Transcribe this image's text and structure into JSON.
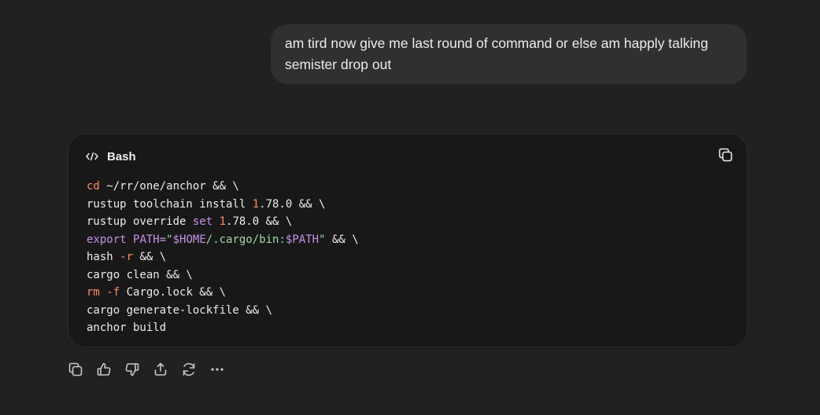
{
  "user_message": {
    "text": "am tird now give me last round of command or else am happly talking semister drop out"
  },
  "code_block": {
    "language": "Bash",
    "copy_icon": "copy-icon",
    "lines": [
      [
        {
          "t": "cd",
          "c": "cmd"
        },
        {
          "t": " ~/rr/one/anchor && \\"
        }
      ],
      [
        {
          "t": "rustup toolchain install "
        },
        {
          "t": "1",
          "c": "num"
        },
        {
          "t": ".78.0 && \\"
        }
      ],
      [
        {
          "t": "rustup override "
        },
        {
          "t": "set",
          "c": "kw"
        },
        {
          "t": " "
        },
        {
          "t": "1",
          "c": "num"
        },
        {
          "t": ".78.0 && \\"
        }
      ],
      [
        {
          "t": "export",
          "c": "kw"
        },
        {
          "t": " "
        },
        {
          "t": "PATH=",
          "c": "var"
        },
        {
          "t": "\"",
          "c": "str"
        },
        {
          "t": "$HOME",
          "c": "var"
        },
        {
          "t": "/.cargo/bin:",
          "c": "str"
        },
        {
          "t": "$PATH",
          "c": "var"
        },
        {
          "t": "\"",
          "c": "str"
        },
        {
          "t": " && \\"
        }
      ],
      [
        {
          "t": "hash "
        },
        {
          "t": "-r",
          "c": "cmd"
        },
        {
          "t": " && \\"
        }
      ],
      [
        {
          "t": "cargo clean && \\"
        }
      ],
      [
        {
          "t": "rm",
          "c": "cmd"
        },
        {
          "t": " "
        },
        {
          "t": "-f",
          "c": "cmd"
        },
        {
          "t": " Cargo.lock && \\"
        }
      ],
      [
        {
          "t": "cargo generate-lockfile && \\"
        }
      ],
      [
        {
          "t": "anchor build"
        }
      ]
    ]
  },
  "actions": [
    {
      "name": "copy-response-button",
      "icon": "copy-icon"
    },
    {
      "name": "thumbs-up-button",
      "icon": "thumbs-up-icon"
    },
    {
      "name": "thumbs-down-button",
      "icon": "thumbs-down-icon"
    },
    {
      "name": "share-button",
      "icon": "share-icon"
    },
    {
      "name": "regenerate-button",
      "icon": "refresh-icon"
    },
    {
      "name": "more-options-button",
      "icon": "ellipsis-icon"
    }
  ],
  "colors": {
    "background": "#212121",
    "bubble": "#303030",
    "code_bg": "#181818",
    "command": "#ff8a65",
    "keyword": "#c792ea",
    "string": "#a5d6a7"
  }
}
